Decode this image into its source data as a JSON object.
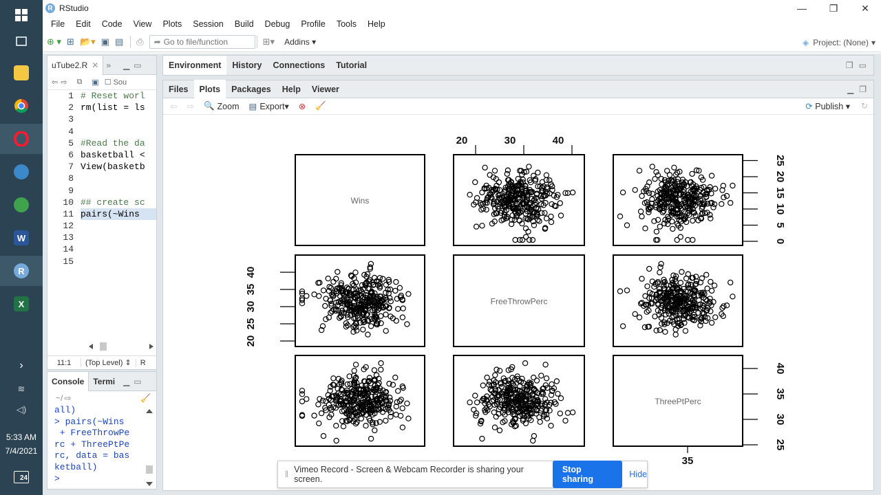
{
  "window": {
    "title": "RStudio"
  },
  "menu": [
    "File",
    "Edit",
    "Code",
    "View",
    "Plots",
    "Session",
    "Build",
    "Debug",
    "Profile",
    "Tools",
    "Help"
  ],
  "toolbar": {
    "goto_placeholder": "Go to file/function",
    "addins_label": "Addins",
    "project_label": "Project: (None)"
  },
  "source": {
    "tab_label": "uTube2.R",
    "source_checkbox_label": "Sou",
    "lines": [
      {
        "n": "1",
        "text": "# Reset worl",
        "kind": "comment"
      },
      {
        "n": "2",
        "text": "rm(list = ls",
        "kind": "code"
      },
      {
        "n": "3",
        "text": "",
        "kind": "code"
      },
      {
        "n": "4",
        "text": "",
        "kind": "code"
      },
      {
        "n": "5",
        "text": "#Read the da",
        "kind": "comment"
      },
      {
        "n": "6",
        "text": "basketball <",
        "kind": "code"
      },
      {
        "n": "7",
        "text": "View(basketb",
        "kind": "code"
      },
      {
        "n": "8",
        "text": "",
        "kind": "code"
      },
      {
        "n": "9",
        "text": "",
        "kind": "code"
      },
      {
        "n": "10",
        "text": "## create sc",
        "kind": "comment"
      },
      {
        "n": "11",
        "text": "pairs(~Wins ",
        "kind": "selected"
      },
      {
        "n": "12",
        "text": "",
        "kind": "code"
      },
      {
        "n": "13",
        "text": "",
        "kind": "code"
      },
      {
        "n": "14",
        "text": "",
        "kind": "code"
      },
      {
        "n": "15",
        "text": "",
        "kind": "code"
      }
    ],
    "status_position": "11:1",
    "status_scope": "(Top Level)",
    "status_lang": "R"
  },
  "console": {
    "tab_console": "Console",
    "tab_terminal": "Termi",
    "path": "~/",
    "lines": [
      "all)",
      "> pairs(~Wins",
      " + FreeThrowPe",
      "rc + ThreePtPe",
      "rc, data = bas",
      "ketball)",
      "> "
    ]
  },
  "env_tabs": [
    "Environment",
    "History",
    "Connections",
    "Tutorial"
  ],
  "plots_tabs": [
    "Files",
    "Plots",
    "Packages",
    "Help",
    "Viewer"
  ],
  "plots_toolbar": {
    "zoom": "Zoom",
    "export": "Export",
    "publish": "Publish"
  },
  "chart_data": {
    "type": "scatter",
    "variables": [
      "Wins",
      "FreeThrowPerc",
      "ThreePtPerc"
    ],
    "axis_ticks": {
      "top": [
        "20",
        "30",
        "40"
      ],
      "right_row1": [
        "0",
        "5",
        "10",
        "15",
        "20",
        "25"
      ],
      "left_row2": [
        "20",
        "25",
        "30",
        "35",
        "40"
      ],
      "right_row3": [
        "25",
        "30",
        "35",
        "40"
      ],
      "bottom": [
        "35"
      ]
    },
    "ranges": {
      "Wins": [
        0,
        26
      ],
      "FreeThrowPerc": [
        20,
        42
      ],
      "ThreePtPerc": [
        25,
        41
      ]
    }
  },
  "taskbar": {
    "time": "5:33 AM",
    "date": "7/4/2021",
    "notification_count": "24"
  },
  "share_banner": {
    "message": "Vimeo Record - Screen & Webcam Recorder is sharing your screen.",
    "stop_label": "Stop sharing",
    "hide_label": "Hide"
  }
}
